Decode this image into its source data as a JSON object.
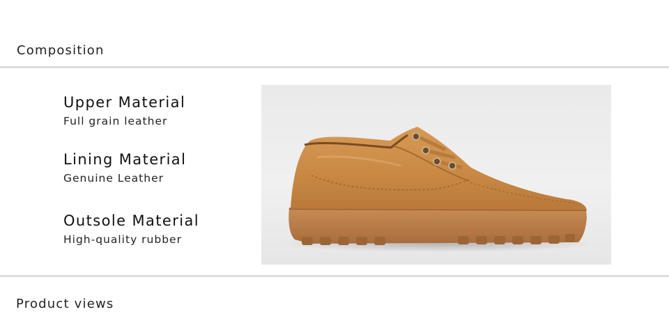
{
  "sections": {
    "composition_title": "Composition",
    "product_views_title": "Product views"
  },
  "specs": [
    {
      "title": "Upper Material",
      "value": "Full grain leather"
    },
    {
      "title": "Lining Material",
      "value": "Genuine Leather"
    },
    {
      "title": "Outsole Material",
      "value": "High-quality rubber"
    }
  ],
  "image": {
    "subject": "tan leather lace-up work shoe",
    "background_color": "#ececec",
    "upper_color": "#c98a45",
    "sole_color": "#b97d45"
  }
}
